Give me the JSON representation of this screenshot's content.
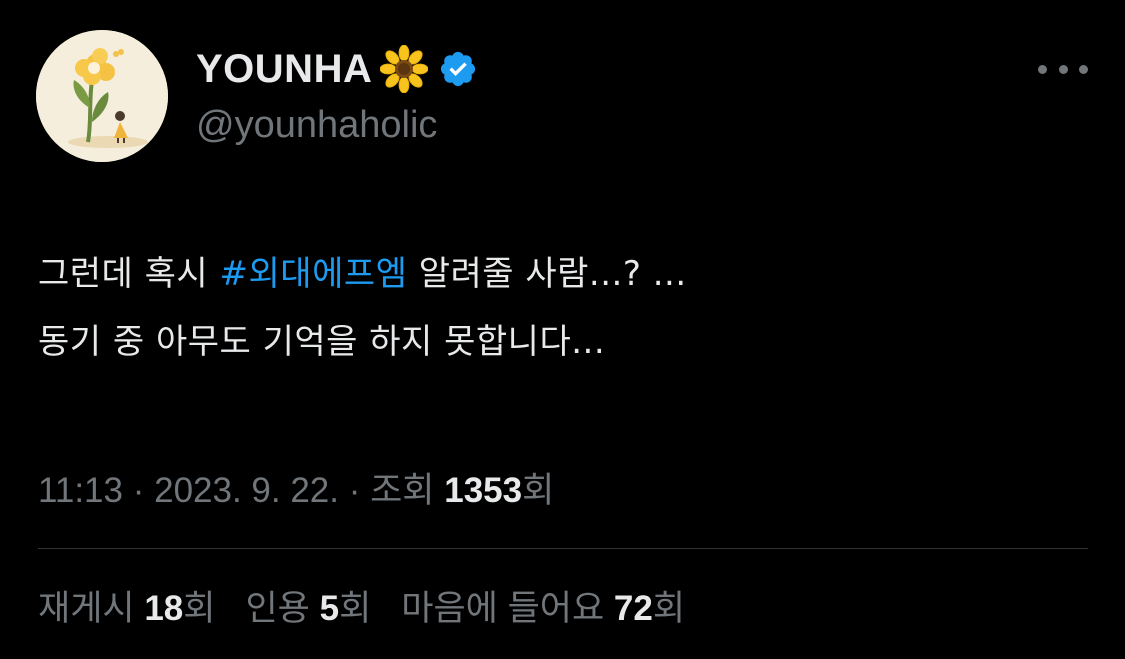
{
  "author": {
    "display_name": "YOUNHA",
    "handle": "@younhaholic",
    "name_emoji": "sunflower-icon",
    "verified": true,
    "verified_color": "#1d9bf0"
  },
  "tweet": {
    "line1_before": "그런데 혹시 ",
    "hashtag": "#외대에프엠",
    "line1_after": " 알려줄 사람...? ...",
    "line2": "동기 중 아무도 기억을 하지 못합니다..."
  },
  "meta": {
    "time": "11:13",
    "separator": " · ",
    "date": "2023. 9. 22.",
    "views_label": "조회 ",
    "views_count": "1353",
    "views_suffix": "회"
  },
  "stats": {
    "retweets_label": "재게시 ",
    "retweets_count": "18",
    "retweets_suffix": "회",
    "quotes_label": "인용 ",
    "quotes_count": "5",
    "quotes_suffix": "회",
    "likes_label": "마음에 들어요 ",
    "likes_count": "72",
    "likes_suffix": "회"
  },
  "colors": {
    "background": "#000000",
    "text": "#e7e9ea",
    "secondary": "#71767b",
    "accent": "#1d9bf0",
    "divider": "#2f3336"
  }
}
